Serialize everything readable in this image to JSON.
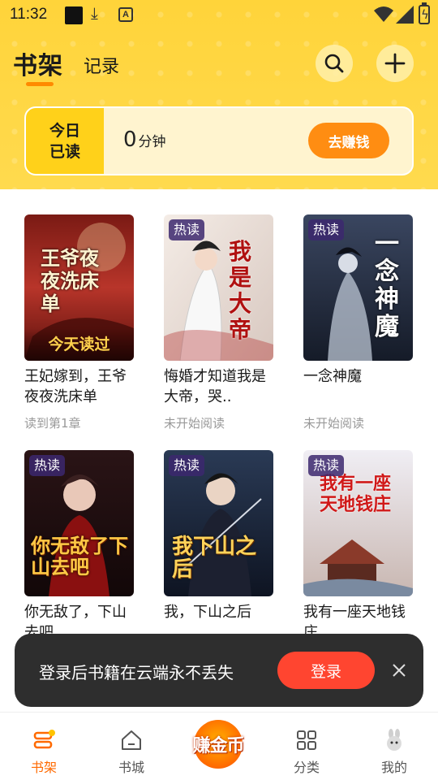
{
  "status_bar": {
    "time": "11:32",
    "a_icon_letter": "A"
  },
  "header": {
    "tab_shelf": "书架",
    "tab_record": "记录"
  },
  "reading_card": {
    "label_line1": "今日",
    "label_line2": "已读",
    "minutes": "0",
    "minutes_unit": "分钟",
    "earn_button": "去赚钱"
  },
  "books": [
    {
      "title": "王妃嫁到，王爷夜夜洗床单",
      "status": "读到第1章",
      "badge": "",
      "overlay": "今天读过",
      "cover_text": "王爷夜夜洗床单"
    },
    {
      "title": "悔婚才知道我是大帝，哭..",
      "status": "未开始阅读",
      "badge": "热读",
      "overlay": "",
      "cover_text": "我是大帝"
    },
    {
      "title": "一念神魔",
      "status": "未开始阅读",
      "badge": "热读",
      "overlay": "",
      "cover_text": "一念神魔"
    },
    {
      "title": "你无敌了，下山去吧",
      "status": "",
      "badge": "热读",
      "overlay": "",
      "cover_text": "你无敌了下山去吧"
    },
    {
      "title": "我，下山之后",
      "status": "",
      "badge": "热读",
      "overlay": "",
      "cover_text": "我下山之后"
    },
    {
      "title": "我有一座天地钱庄",
      "status": "",
      "badge": "热读",
      "overlay": "",
      "cover_text": "我有一座天地钱庄"
    }
  ],
  "toast": {
    "message": "登录后书籍在云端永不丢失",
    "login_button": "登录"
  },
  "bottom_nav": {
    "items": [
      {
        "label": "书架",
        "icon": "bookshelf-icon",
        "active": true
      },
      {
        "label": "书城",
        "icon": "home-icon",
        "active": false
      },
      {
        "label": "分类",
        "icon": "grid-icon",
        "active": false
      },
      {
        "label": "我的",
        "icon": "profile-icon",
        "active": false
      }
    ],
    "center_button": "赚金币"
  },
  "colors": {
    "accent": "#ff8d12",
    "header_yellow": "#ffd43a",
    "login_red": "#ff4530",
    "active_tab": "#ff6a00"
  }
}
